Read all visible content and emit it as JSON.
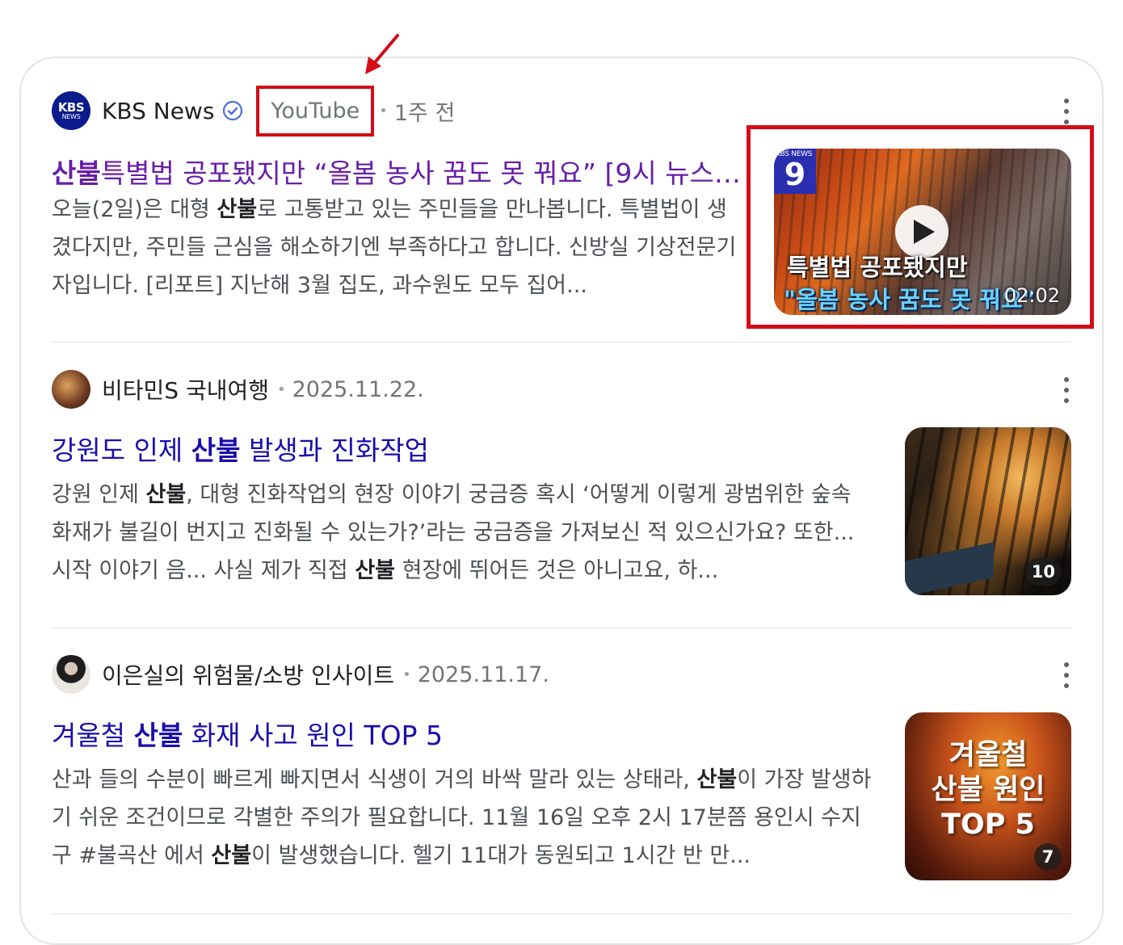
{
  "results": [
    {
      "source": {
        "name": "KBS News",
        "logo_top": "KBS",
        "logo_bottom": "NEWS",
        "sub": "YouTube",
        "time": "1주 전",
        "verified": true
      },
      "title_highlight": "산불",
      "title_rest": "특별법 공포됐지만 “올봄 농사 꿈도 못 꿔요” [9시 뉴스] ...",
      "snippet_a": "오늘(2일)은 대형 ",
      "snippet_b": "산불",
      "snippet_c": "로 고통받고 있는 주민들을 만나봅니다. 특별법이 생겼다지만, 주민들 근심을 해소하기엔 부족하다고 합니다. 신방실 기상전문기자입니다. [리포트] 지난해 3월 집도, 과수원도 모두 집어...",
      "thumbnail": {
        "logo": "KBS NEWS",
        "channel": "9",
        "caption_line1": "특별법 공포됐지만",
        "caption_line2": "\"올봄 농사 꿈도 못 꿔요\"",
        "duration": "02:02"
      }
    },
    {
      "source": {
        "name": "비타민S 국내여행",
        "time": "2025.11.22."
      },
      "title_a": "강원도 인제 ",
      "title_b": "산불",
      "title_c": " 발생과 진화작업",
      "snippet_a": "강원 인제 ",
      "snippet_b": "산불",
      "snippet_c": ", 대형 진화작업의 현장 이야기 궁금증 혹시 ‘어떻게 이렇게 광범위한 숲속 화재가 불길이 번지고 진화될 수 있는가?’라는 궁금증을 가져보신 적 있으신가요? 또한... 시작 이야기 음... 사실 제가 직접 ",
      "snippet_d": "산불",
      "snippet_e": " 현장에 뛰어든 것은 아니고요, 하...",
      "thumbnail": {
        "count": "10"
      }
    },
    {
      "source": {
        "name": "이은실의 위험물/소방 인사이트",
        "time": "2025.11.17."
      },
      "title_a": "겨울철 ",
      "title_b": "산불",
      "title_c": " 화재 사고 원인 TOP 5",
      "snippet_a": "산과 들의 수분이 빠르게 빠지면서 식생이 거의 바싹 말라 있는 상태라, ",
      "snippet_b": "산불",
      "snippet_c": "이 가장 발생하기 쉬운 조건이므로 각별한 주의가 필요합니다. 11월 16일 오후 2시 17분쯤 용인시 수지구 #불곡산 에서 ",
      "snippet_d": "산불",
      "snippet_e": "이 발생했습니다. 헬기 11대가 동원되고 1시간 반 만...",
      "thumbnail": {
        "caption_line1": "겨울철",
        "caption_line2": "산불 원인",
        "caption_line3": "TOP 5",
        "count": "7"
      }
    }
  ],
  "colors": {
    "link": "#1a0dab",
    "visited": "#681da8",
    "annotation_red": "#d50b17"
  }
}
